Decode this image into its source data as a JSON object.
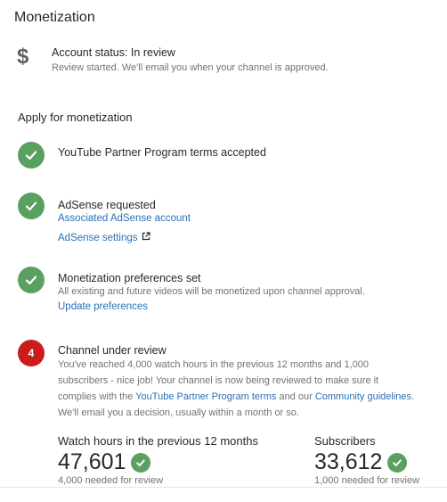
{
  "page": {
    "title": "Monetization"
  },
  "account": {
    "status": "Account status: In review",
    "description": "Review started. We'll email you when your channel is approved."
  },
  "apply": {
    "heading": "Apply for monetization",
    "steps": [
      {
        "title": "YouTube Partner Program terms accepted"
      },
      {
        "title": "AdSense requested",
        "links": [
          "Associated AdSense account",
          "AdSense settings"
        ]
      },
      {
        "title": "Monetization preferences set",
        "description": "All existing and future videos will be monetized upon channel approval.",
        "link": "Update preferences"
      },
      {
        "number": "4",
        "title": "Channel under review",
        "desc_line1": "You've reached 4,000 watch hours in the previous 12 months and 1,000",
        "desc_line2a": "subscribers - nice job! Your channel is now being reviewed to make sure it",
        "desc_line3a": "complies with the ",
        "desc_link1": "YouTube Partner Program terms",
        "desc_line3b": " and our ",
        "desc_link2": "Community guidelines",
        "desc_line3c": ".",
        "desc_line4": "We'll email you a decision, usually within a month or so."
      }
    ]
  },
  "stats": {
    "watch_hours": {
      "label": "Watch hours in the previous 12 months",
      "value": "47,601",
      "note": "4,000 needed for review"
    },
    "subscribers": {
      "label": "Subscribers",
      "value": "33,612",
      "note": "1,000 needed for review"
    }
  },
  "colors": {
    "check_green": "#5aa061",
    "step_red": "#cc1b1b",
    "link_blue": "#2a6fb5"
  }
}
